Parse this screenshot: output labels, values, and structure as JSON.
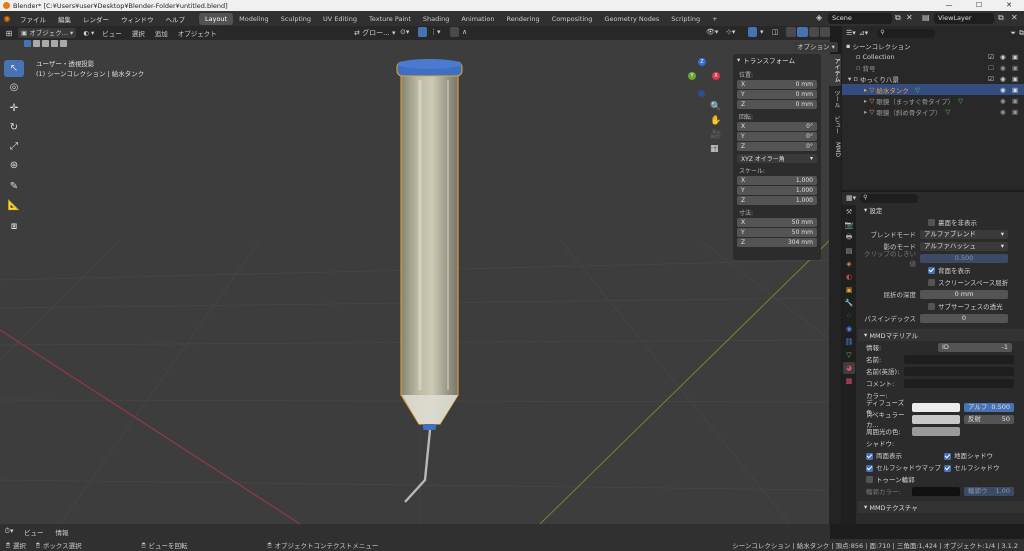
{
  "window": {
    "title": "Blender* [C:¥Users¥user¥Desktop¥Blender-Folder¥untitled.blend]"
  },
  "menu": [
    "ファイル",
    "編集",
    "レンダー",
    "ウィンドウ",
    "ヘルプ"
  ],
  "workspaces": [
    "Layout",
    "Modeling",
    "Sculpting",
    "UV Editing",
    "Texture Paint",
    "Shading",
    "Animation",
    "Rendering",
    "Compositing",
    "Geometry Nodes",
    "Scripting"
  ],
  "active_workspace": "Layout",
  "scene": {
    "name": "Scene",
    "view_layer": "ViewLayer"
  },
  "viewport_header": {
    "mode": "オブジェク...",
    "menus": [
      "ビュー",
      "選択",
      "追加",
      "オブジェクト"
    ],
    "transform_orientation": "グロー...",
    "options": "オプション"
  },
  "viewport": {
    "view_name": "ユーザー・透視投影",
    "collection_info": "(1) シーンコレクション | 給水タンク"
  },
  "npanel": {
    "section": "トランスフォーム",
    "location_label": "位置:",
    "location": [
      [
        "X",
        "0 mm"
      ],
      [
        "Y",
        "0 mm"
      ],
      [
        "Z",
        "0 mm"
      ]
    ],
    "rotation_label": "回転:",
    "rotation": [
      [
        "X",
        "0°"
      ],
      [
        "Y",
        "0°"
      ],
      [
        "Z",
        "0°"
      ]
    ],
    "rotation_mode": "XYZ オイラー角",
    "scale_label": "スケール:",
    "scale": [
      [
        "X",
        "1.000"
      ],
      [
        "Y",
        "1.000"
      ],
      [
        "Z",
        "1.000"
      ]
    ],
    "dimensions_label": "寸法:",
    "dimensions": [
      [
        "X",
        "50 mm"
      ],
      [
        "Y",
        "50 mm"
      ],
      [
        "Z",
        "304 mm"
      ]
    ],
    "tabs": [
      "アイテム",
      "ツール",
      "ビュー",
      "MMD"
    ]
  },
  "outliner": {
    "root": "シーンコレクション",
    "items": [
      {
        "label": "Collection"
      },
      {
        "label": "背号"
      },
      {
        "label": "ゆっくり八景"
      },
      {
        "label": "給水タンク"
      },
      {
        "label": "眼鏡（まっすぐ骨タイプ）"
      },
      {
        "label": "眼鏡（斜め骨タイプ）"
      }
    ]
  },
  "properties": {
    "section_settings": "設定",
    "backface_hide": "裏面を非表示",
    "blend_mode_label": "ブレンドモード",
    "blend_mode": "アルファブレンド",
    "shadow_mode_label": "影のモード",
    "shadow_mode": "アルファハッシュ",
    "clip_threshold_label": "クリップのしきい値",
    "clip_threshold": "0.500",
    "show_backface": "背面を表示",
    "screen_refraction": "スクリーンスペース屈折",
    "refraction_depth_label": "屈折の深度",
    "refraction_depth": "0 mm",
    "subsurface": "サブサーフェスの透光",
    "pass_index_label": "パスインデックス",
    "pass_index": "0",
    "mmd_section": "MMDマテリアル",
    "info_label": "情報:",
    "id_label": "ID",
    "id_value": "-1",
    "name_label": "名前:",
    "name_en_label": "名前(英語):",
    "comment_label": "コメント:",
    "color_label": "カラー:",
    "diffuse_label": "ディフューズ色:",
    "alpha_label": "アルフ",
    "alpha_value": "0.500",
    "specular_label": "スペキュラーカ...",
    "reflect_label": "反射",
    "reflect_value": "50",
    "ambient_label": "周囲光の色:",
    "shadow_label": "シャドウ:",
    "double_sided": "両面表示",
    "ground_shadow": "地面シャドウ",
    "self_shadow_map": "セルフシャドウマップ",
    "self_shadow": "セルフシャドウ",
    "toon_edge": "トゥーン輪郭",
    "edge_color_label": "輪郭カラー:",
    "edge_weight_label": "輪郭ウ",
    "edge_weight": "1.00",
    "mmd_texture": "MMDテクスチャ"
  },
  "bottom": {
    "view": "ビュー",
    "info": "情報"
  },
  "status": {
    "select": "選択",
    "box_select": "ボックス選択",
    "rotate_view": "ビューを回転",
    "context_menu": "オブジェクトコンテクストメニュー",
    "stats": "シーンコレクション | 給水タンク | 頂点:856 | 面:710 | 三角面:1,424 | オブジェクト:1/4 | 3.1.2"
  },
  "colors": {
    "accent": "#4772b3",
    "selected": "#e9a33b",
    "cap": "#3f6fc0"
  }
}
